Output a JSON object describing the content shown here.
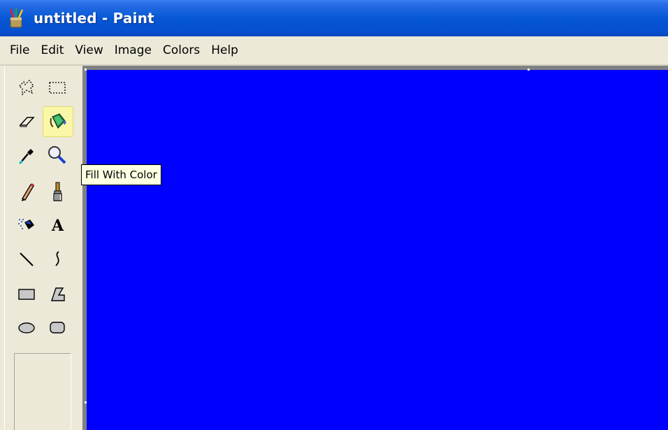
{
  "window": {
    "title": "untitled - Paint"
  },
  "menu": {
    "items": [
      "File",
      "Edit",
      "View",
      "Image",
      "Colors",
      "Help"
    ]
  },
  "tools": [
    {
      "name": "free-form-select",
      "selected": false
    },
    {
      "name": "rectangle-select",
      "selected": false
    },
    {
      "name": "eraser",
      "selected": false
    },
    {
      "name": "fill-with-color",
      "selected": true
    },
    {
      "name": "pick-color",
      "selected": false
    },
    {
      "name": "magnifier",
      "selected": false
    },
    {
      "name": "pencil",
      "selected": false
    },
    {
      "name": "brush",
      "selected": false
    },
    {
      "name": "airbrush",
      "selected": false
    },
    {
      "name": "text",
      "selected": false
    },
    {
      "name": "line",
      "selected": false
    },
    {
      "name": "curve",
      "selected": false
    },
    {
      "name": "rectangle",
      "selected": false
    },
    {
      "name": "polygon",
      "selected": false
    },
    {
      "name": "ellipse",
      "selected": false
    },
    {
      "name": "rounded-rectangle",
      "selected": false
    }
  ],
  "tooltip": {
    "text": "Fill With Color"
  },
  "canvas": {
    "fill_color": "#0000ff"
  },
  "colors": {
    "titlebar": "#0554d3",
    "tooltip_bg": "#ffffe1",
    "selected_tool_bg": "#fbf7a8"
  }
}
